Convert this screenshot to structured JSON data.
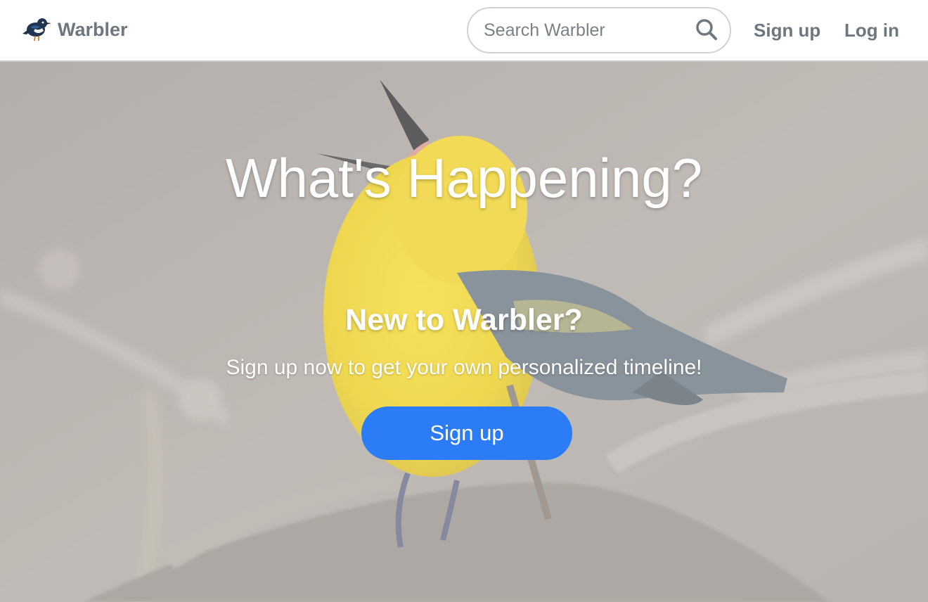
{
  "navbar": {
    "brand_name": "Warbler",
    "search_placeholder": "Search Warbler",
    "signup_label": "Sign up",
    "login_label": "Log in",
    "text_color": "#6c7780"
  },
  "hero": {
    "title": "What's Happening?",
    "subtitle": "New to Warbler?",
    "lead": "Sign up now to get your own personalized timeline!",
    "cta_label": "Sign up",
    "cta_color": "#2b7cf6"
  },
  "icons": {
    "brand": "bird-logo-icon",
    "search": "search-icon"
  }
}
